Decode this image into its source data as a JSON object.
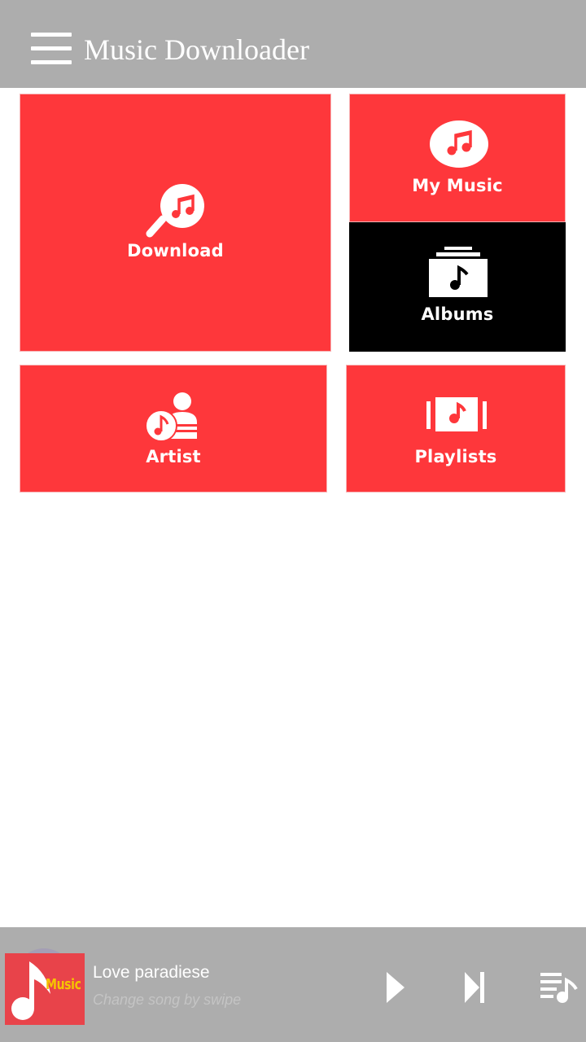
{
  "app_bar": {
    "title": "Music Downloader",
    "menu_icon": "hamburger-menu-icon",
    "background": "#adadad"
  },
  "tiles": {
    "download": {
      "label": "Download",
      "icon": "search-music-icon",
      "color": "#fe373b"
    },
    "my_music": {
      "label": "My Music",
      "icon": "music-note-circle-icon",
      "color": "#fe373b"
    },
    "albums": {
      "label": "Albums",
      "icon": "album-stack-icon",
      "color": "#000000"
    },
    "artist": {
      "label": "Artist",
      "icon": "artist-icon",
      "color": "#fe373b"
    },
    "playlists": {
      "label": "Playlists",
      "icon": "playlist-icon",
      "color": "#fe373b"
    }
  },
  "player": {
    "album_art_text": "Music",
    "song_title": "Love paradiese",
    "hint": "Change song by swipe",
    "play_icon": "play-icon",
    "next_icon": "skip-next-icon",
    "queue_icon": "queue-music-icon"
  },
  "colors": {
    "accent": "#fe373b",
    "bar": "#adadad",
    "album_logo_text": "#f5c400"
  }
}
